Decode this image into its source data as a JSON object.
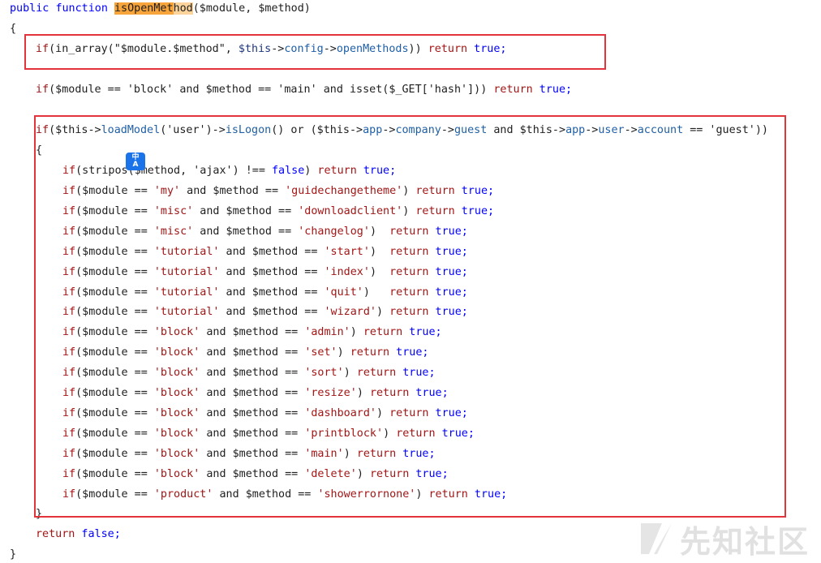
{
  "code": {
    "header": {
      "kw1": "public",
      "kw2": "function",
      "fn_hl": "isOpenMet",
      "fn_rest": "hod",
      "params": "($module, $method)"
    },
    "open_brace": "{",
    "close_brace": "}",
    "inner_open": "{",
    "inner_close": "}",
    "line_in_array": {
      "kw": "if",
      "text": "(in_array(\"$module.$method\", ",
      "this": "$this",
      "arrow1": "->",
      "config": "config",
      "arrow2": "->",
      "open": "openMethods",
      "tail": ")) ",
      "ret": "return",
      "val": " true;"
    },
    "line_block_main": {
      "kw": "if",
      "text": "($module == 'block' and $method == 'main' and isset($_GET['hash'])) ",
      "ret": "return",
      "val": " true;"
    },
    "line_logon": {
      "kw": "if",
      "p1": "($this->",
      "load": "loadModel",
      "p2": "('user')->",
      "islogon": "isLogon",
      "p3": "() or ($this->",
      "app1": "app",
      "p4": "->",
      "company": "company",
      "p5": "->",
      "guest": "guest",
      "p6": " and $this->",
      "app2": "app",
      "p7": "->",
      "user": "user",
      "p8": "->",
      "account": "account",
      "p9": " == 'guest'))"
    },
    "line_stripos": {
      "kw": "if",
      "text": "(stripos($method, 'ajax') !== ",
      "false": "false",
      "tail": ") ",
      "ret": "return",
      "val": " true;"
    },
    "rules": [
      {
        "module": "'my'",
        "method": "'guidechangetheme'",
        "gap": ") "
      },
      {
        "module": "'misc'",
        "method": "'downloadclient'",
        "gap": ") "
      },
      {
        "module": "'misc'",
        "method": "'changelog'",
        "gap": ")  "
      },
      {
        "module": "'tutorial'",
        "method": "'start'",
        "gap": ")  "
      },
      {
        "module": "'tutorial'",
        "method": "'index'",
        "gap": ")  "
      },
      {
        "module": "'tutorial'",
        "method": "'quit'",
        "gap": ")   "
      },
      {
        "module": "'tutorial'",
        "method": "'wizard'",
        "gap": ") "
      },
      {
        "module": "'block'",
        "method": "'admin'",
        "gap": ") "
      },
      {
        "module": "'block'",
        "method": "'set'",
        "gap": ") "
      },
      {
        "module": "'block'",
        "method": "'sort'",
        "gap": ") "
      },
      {
        "module": "'block'",
        "method": "'resize'",
        "gap": ") "
      },
      {
        "module": "'block'",
        "method": "'dashboard'",
        "gap": ") "
      },
      {
        "module": "'block'",
        "method": "'printblock'",
        "gap": ") "
      },
      {
        "module": "'block'",
        "method": "'main'",
        "gap": ") "
      },
      {
        "module": "'block'",
        "method": "'delete'",
        "gap": ") "
      },
      {
        "module": "'product'",
        "method": "'showerrornone'",
        "gap": ") "
      }
    ],
    "rule_tokens": {
      "kw": "if",
      "open": "($module == ",
      "mid": " and $method == ",
      "ret": "return",
      "val": " true;"
    },
    "line_return_false": {
      "ret": "return",
      "val": " false;"
    }
  },
  "translate_icon": {
    "label_top": "中",
    "label_bottom": "A"
  },
  "watermark": {
    "text": "先知社区"
  },
  "colors": {
    "highlight": "#f7a43a",
    "box": "#e2343a",
    "keyword": "#0000ff",
    "return": "#a31515"
  }
}
